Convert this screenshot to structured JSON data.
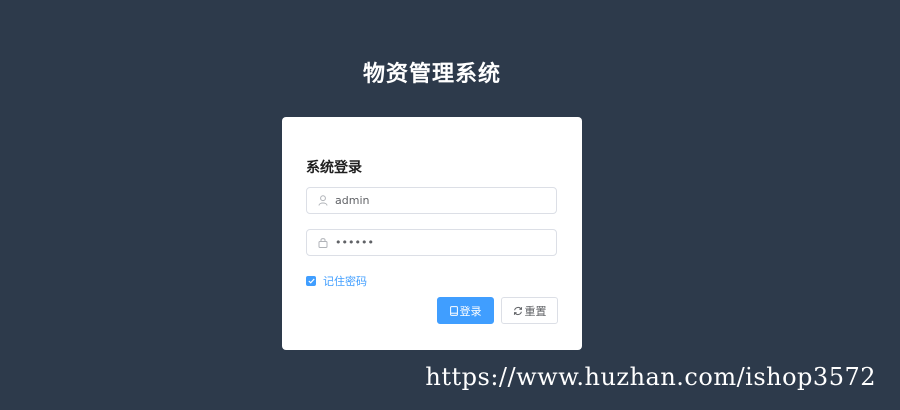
{
  "app": {
    "title": "物资管理系统"
  },
  "login": {
    "title": "系统登录",
    "username": {
      "value": "admin",
      "icon": "user-icon"
    },
    "password": {
      "value": "••••••",
      "icon": "lock-icon"
    },
    "remember": {
      "label": "记住密码",
      "checked": true
    },
    "buttons": {
      "login_label": "登录",
      "login_icon": "mobile-icon",
      "reset_label": "重置",
      "reset_icon": "refresh-icon"
    }
  },
  "watermark": {
    "text": "https://www.huzhan.com/ishop3572"
  },
  "colors": {
    "background": "#2d3a4b",
    "card": "#ffffff",
    "accent": "#409eff",
    "border": "#dcdfe6",
    "text": "#606266"
  }
}
